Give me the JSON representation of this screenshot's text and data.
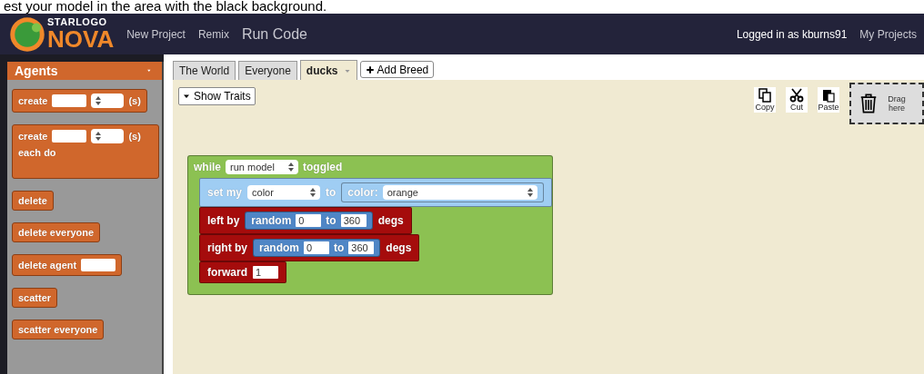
{
  "caption": "est your model in the area with the black background.",
  "header": {
    "logo_top": "STARLOGO",
    "logo_bottom": "NOVA",
    "nav": [
      "New Project",
      "Remix",
      "Run Code"
    ],
    "user": "Logged in as kburns91",
    "my_projects": "My Projects"
  },
  "palette": {
    "title": "Agents",
    "blocks": [
      {
        "kind": "stack",
        "lines": [
          [
            {
              "kind": "text",
              "text": "create"
            },
            {
              "kind": "field"
            },
            {
              "kind": "select"
            },
            {
              "kind": "text",
              "text": "(s)"
            }
          ]
        ]
      },
      {
        "kind": "c-block",
        "lines": [
          [
            {
              "kind": "text",
              "text": "create"
            },
            {
              "kind": "field"
            },
            {
              "kind": "select"
            },
            {
              "kind": "text",
              "text": "(s)"
            }
          ],
          [
            {
              "kind": "text",
              "text": "each do"
            }
          ]
        ]
      },
      {
        "kind": "stack",
        "lines": [
          [
            {
              "kind": "text",
              "text": "delete"
            }
          ]
        ]
      },
      {
        "kind": "stack",
        "lines": [
          [
            {
              "kind": "text",
              "text": "delete everyone"
            }
          ]
        ]
      },
      {
        "kind": "stack",
        "lines": [
          [
            {
              "kind": "text",
              "text": "delete agent"
            },
            {
              "kind": "field"
            }
          ]
        ]
      },
      {
        "kind": "stack",
        "lines": [
          [
            {
              "kind": "text",
              "text": "scatter"
            }
          ]
        ]
      },
      {
        "kind": "stack",
        "lines": [
          [
            {
              "kind": "text",
              "text": "scatter everyone"
            }
          ]
        ]
      }
    ]
  },
  "tabs": [
    {
      "label": "The World",
      "selected": false
    },
    {
      "label": "Everyone",
      "selected": false
    },
    {
      "label": "ducks",
      "selected": true
    }
  ],
  "add_breed": "Add Breed",
  "show_traits": "Show Traits",
  "tools": [
    "Copy",
    "Cut",
    "Paste"
  ],
  "trash": "Drag here",
  "program": {
    "color": "#8cc152",
    "segments": [
      {
        "kind": "text",
        "text": "while"
      },
      {
        "kind": "select",
        "value": "run model"
      },
      {
        "kind": "text",
        "text": "toggled"
      }
    ],
    "children": [
      {
        "color": "#9fcdf3",
        "segments": [
          {
            "kind": "text",
            "text": "set my"
          },
          {
            "kind": "select",
            "value": "color"
          },
          {
            "kind": "text",
            "text": "to"
          },
          {
            "kind": "reporter",
            "color": "#9fcdf3",
            "segments": [
              {
                "kind": "text",
                "text": "color:"
              },
              {
                "kind": "select",
                "value": "orange"
              }
            ]
          }
        ]
      },
      {
        "color": "#a50c0c",
        "segments": [
          {
            "kind": "text",
            "text": "left by"
          },
          {
            "kind": "reporter",
            "color": "#4f86c6",
            "segments": [
              {
                "kind": "text",
                "text": "random"
              },
              {
                "kind": "field",
                "value": "0"
              },
              {
                "kind": "text",
                "text": "to"
              },
              {
                "kind": "field",
                "value": "360"
              }
            ]
          },
          {
            "kind": "text",
            "text": "degs"
          }
        ]
      },
      {
        "color": "#a50c0c",
        "segments": [
          {
            "kind": "text",
            "text": "right by"
          },
          {
            "kind": "reporter",
            "color": "#4f86c6",
            "segments": [
              {
                "kind": "text",
                "text": "random"
              },
              {
                "kind": "field",
                "value": "0"
              },
              {
                "kind": "text",
                "text": "to"
              },
              {
                "kind": "field",
                "value": "360"
              }
            ]
          },
          {
            "kind": "text",
            "text": "degs"
          }
        ]
      },
      {
        "color": "#a50c0c",
        "segments": [
          {
            "kind": "text",
            "text": "forward"
          },
          {
            "kind": "field",
            "value": "1"
          }
        ]
      }
    ]
  }
}
